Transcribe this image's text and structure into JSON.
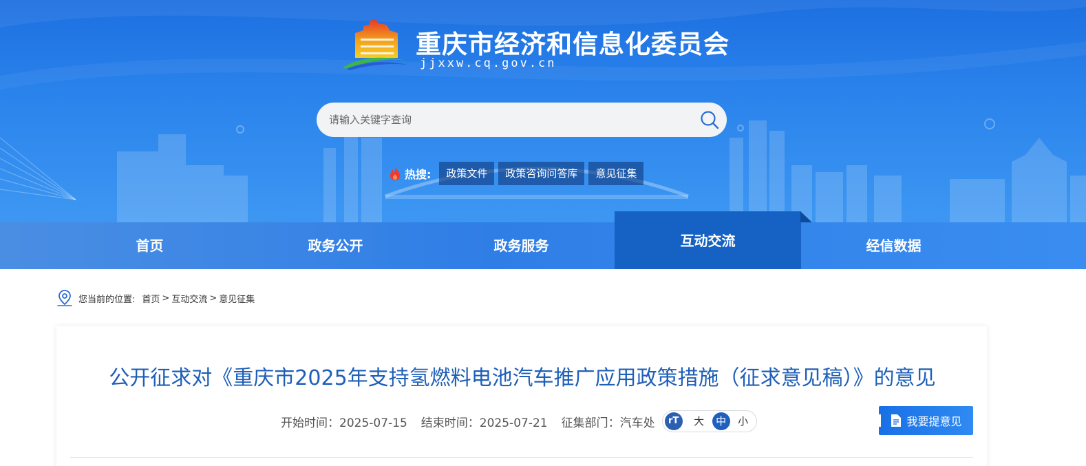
{
  "header": {
    "site_title": "重庆市经济和信息化委员会",
    "site_domain": "jjxxw.cq.gov.cn",
    "search_placeholder": "请输入关键字查询",
    "hot_label": "热搜:",
    "hot_tags": [
      "政策文件",
      "政策咨询问答库",
      "意见征集"
    ]
  },
  "nav": {
    "items": [
      "首页",
      "政务公开",
      "政务服务",
      "互动交流",
      "经信数据"
    ],
    "active": "互动交流"
  },
  "breadcrumb": {
    "label": "您当前的位置:",
    "items": [
      "首页",
      "互动交流",
      "意见征集"
    ],
    "sep1": ">",
    "sep2": ">"
  },
  "article": {
    "title": "公开征求对《重庆市2025年支持氢燃料电池汽车推广应用政策措施（征求意见稿）》的意见",
    "start_time": "开始时间：2025-07-15",
    "end_time": "结束时间：2025-07-21",
    "department": "征集部门：汽车处",
    "font_size": {
      "icon_text": "rT",
      "large": "大",
      "medium": "中",
      "small": "小",
      "selected": "中"
    },
    "submit_button": "我要提意见"
  },
  "colors": {
    "header_blue": "#2b84ec",
    "nav_active": "#1561c4",
    "title_blue": "#1e5fb8",
    "button_blue": "#1970e6"
  },
  "icons": [
    "logo-emblem",
    "search-icon",
    "fire-icon",
    "location-pin-icon",
    "font-size-icon",
    "document-edit-icon"
  ]
}
